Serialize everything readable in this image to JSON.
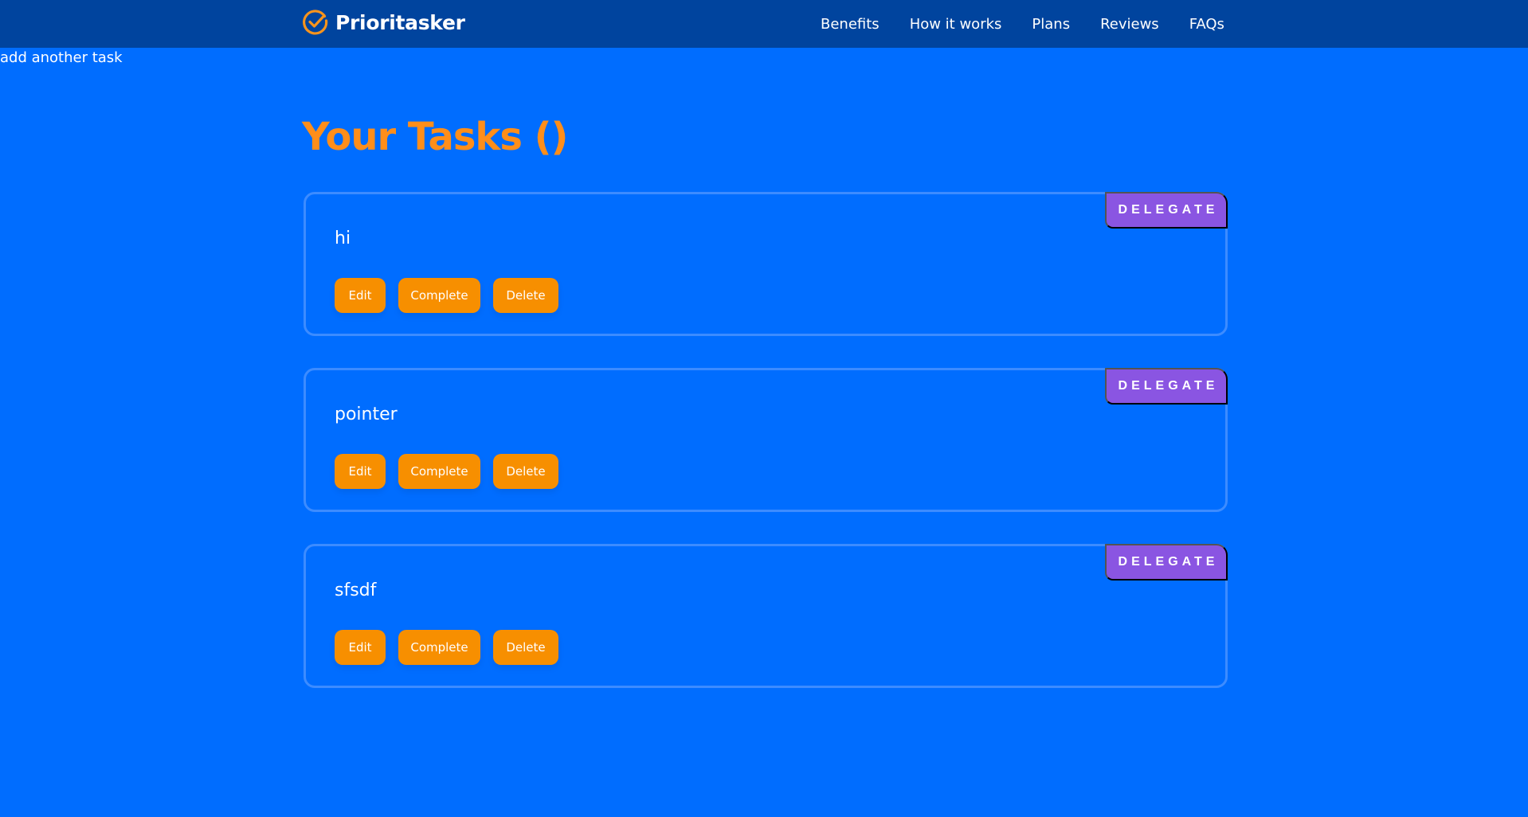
{
  "header": {
    "brand_name": "Prioritasker",
    "logo_icon": "check-circle-icon",
    "nav_links": [
      {
        "label": "Benefits"
      },
      {
        "label": "How it works"
      },
      {
        "label": "Plans"
      },
      {
        "label": "Reviews"
      },
      {
        "label": "FAQs"
      }
    ]
  },
  "add_task_link": "add another task",
  "page_title": "Your Tasks ()",
  "tasks": [
    {
      "name": "hi",
      "delegate_label": "DELEGATE",
      "edit_label": "Edit",
      "complete_label": "Complete",
      "delete_label": "Delete"
    },
    {
      "name": "pointer",
      "delegate_label": "DELEGATE",
      "edit_label": "Edit",
      "complete_label": "Complete",
      "delete_label": "Delete"
    },
    {
      "name": "sfsdf",
      "delegate_label": "DELEGATE",
      "edit_label": "Edit",
      "complete_label": "Complete",
      "delete_label": "Delete"
    }
  ],
  "colors": {
    "nav_background": "#00449e",
    "page_background": "#006dff",
    "title_orange": "#ff8e1a",
    "button_orange": "#f78f00",
    "delegate_purple": "#8a55e2",
    "card_border": "#3d8cff"
  }
}
